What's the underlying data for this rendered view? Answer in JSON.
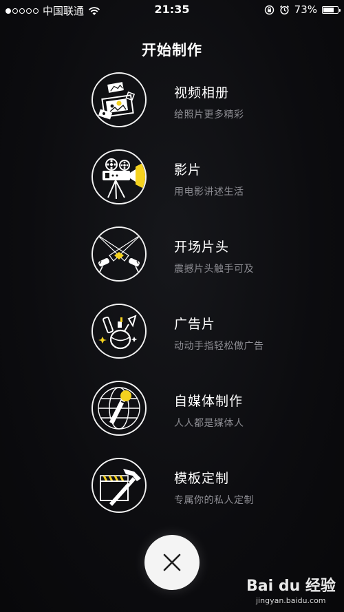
{
  "status_bar": {
    "carrier": "中国联通",
    "time": "21:35",
    "battery_percent": "73%",
    "battery_level": 0.73,
    "signal_dots_filled": 1,
    "icons": [
      "signal-dots-icon",
      "wifi-icon",
      "orientation-lock-icon",
      "alarm-icon",
      "battery-icon"
    ]
  },
  "page": {
    "title": "开始制作"
  },
  "menu": {
    "items": [
      {
        "title": "视频相册",
        "subtitle": "给照片更多精彩",
        "icon": "photo-album-icon"
      },
      {
        "title": "影片",
        "subtitle": "用电影讲述生活",
        "icon": "film-camera-icon"
      },
      {
        "title": "开场片头",
        "subtitle": "震撼片头触手可及",
        "icon": "spotlight-icon"
      },
      {
        "title": "广告片",
        "subtitle": "动动手指轻松做广告",
        "icon": "cosmetics-icon"
      },
      {
        "title": "自媒体制作",
        "subtitle": "人人都是媒体人",
        "icon": "microphone-globe-icon"
      },
      {
        "title": "模板定制",
        "subtitle": "专属你的私人定制",
        "icon": "clapper-hammer-icon"
      }
    ]
  },
  "close": {
    "icon": "close-icon"
  },
  "watermark": {
    "logo": "Bai du 经验",
    "url": "jingyan.baidu.com"
  },
  "colors": {
    "accent": "#f5d21f",
    "background": "#0b0b0e",
    "subtitle": "#8d8d93"
  }
}
